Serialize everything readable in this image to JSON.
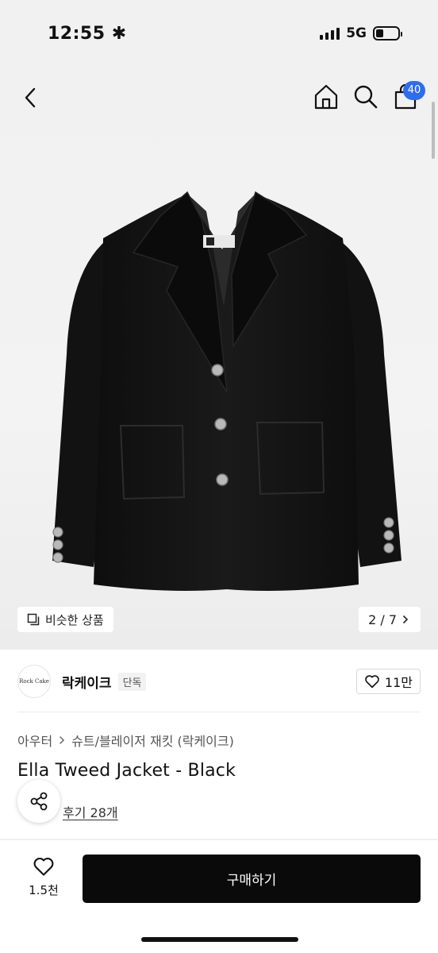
{
  "status_bar": {
    "time": "12:55 ✱",
    "network": "5G"
  },
  "header": {
    "cart_count": "40"
  },
  "icons": {
    "back": "chevron-left-icon",
    "home": "home-icon",
    "search": "search-icon",
    "cart": "shopping-bag-icon",
    "similar": "similar-items-icon",
    "next": "chevron-right-icon",
    "heart": "heart-icon",
    "share": "share-icon"
  },
  "gallery": {
    "similar_label": "비슷한 상품",
    "counter": "2 / 7"
  },
  "brand": {
    "logo_text": "Rock Cake",
    "name": "락케이크",
    "tag": "단독",
    "likes": "11만"
  },
  "product": {
    "category_1": "아우터",
    "category_2": "슈트/블레이저 재킷 (락케이크)",
    "title": "Ella Tweed Jacket - Black",
    "reviews": "후기 28개"
  },
  "bottom_bar": {
    "wish_count": "1.5천",
    "buy_label": "구매하기"
  },
  "colors": {
    "badge": "#2f6df0",
    "buy_button": "#0a0a0a",
    "jacket": "#141414"
  }
}
